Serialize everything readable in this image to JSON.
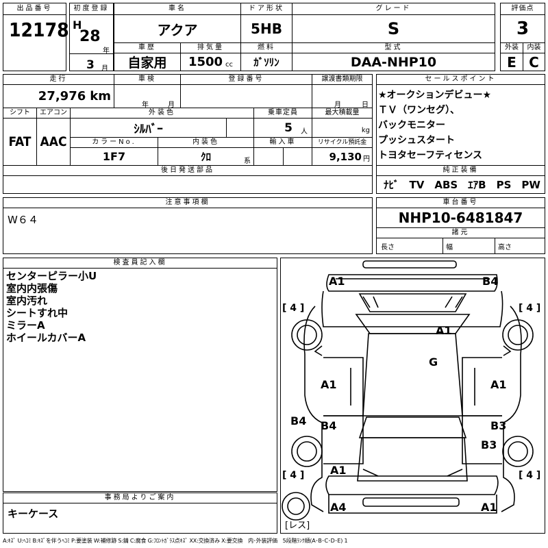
{
  "header": {
    "lot_label": "出品番号",
    "lot_value": "12178",
    "first_reg_label": "初度登録",
    "era": "H",
    "year_value": "28",
    "year_unit": "年",
    "month_value": "3",
    "month_unit": "月",
    "car_name_label": "車名",
    "car_name": "アクア",
    "door_label": "ドア形状",
    "door_value": "5HB",
    "grade_label": "グレード",
    "grade_value": "S",
    "score_label": "評価点",
    "score_value": "3",
    "history_label": "車歴",
    "history_value": "自家用",
    "displacement_label": "排気量",
    "displacement_value": "1500",
    "displacement_unit": "cc",
    "fuel_label": "燃料",
    "fuel_value": "ｶﾞｿﾘﾝ",
    "model_label": "型式",
    "model_value": "DAA-NHP10",
    "ext_label": "外装",
    "ext_value": "E",
    "int_label": "内装",
    "int_value": "C"
  },
  "specs": {
    "mileage_label": "走行",
    "mileage_value": "27,976",
    "mileage_unit": "km",
    "inspection_label": "車検",
    "year_unit": "年",
    "month_unit": "月",
    "reg_no_label": "登録番号",
    "transfer_label": "譲渡書類期限",
    "transfer_month": "月",
    "transfer_day": "日",
    "shift_label": "シフト",
    "shift_value": "FAT",
    "ac_label": "エアコン",
    "ac_value": "AAC",
    "ext_color_label": "外装色",
    "ext_color_value": "ｼﾙﾊﾞｰ",
    "capacity_label": "乗車定員",
    "capacity_value": "5",
    "capacity_unit": "人",
    "max_load_label": "最大積載量",
    "max_load_unit": "kg",
    "color_no_label": "カラーNo.",
    "color_no_value": "1F7",
    "int_color_label": "内装色",
    "int_color_value": "ｸﾛ",
    "int_color_unit": "系",
    "import_label": "輸入車",
    "recycle_label": "リサイクル預託金",
    "recycle_value": "9,130",
    "recycle_unit": "円",
    "later_parts_label": "後日発送部品"
  },
  "selling": {
    "label": "セールスポイント",
    "lines": [
      "★オークションデビュー★",
      "ＴＶ（ワンセグ）、",
      "バックモニター",
      "プッシュスタート",
      "トヨタセーフティセンス"
    ]
  },
  "equipment": {
    "label": "純正装備",
    "value": "ﾅﾋﾞ　TV　ABS　ｴｱB　PS　PW"
  },
  "notes": {
    "label": "注意事項欄",
    "value": "W６４"
  },
  "chassis": {
    "label": "車台番号",
    "value": "NHP10-6481847",
    "dims_label": "諸元",
    "length_label": "長さ",
    "width_label": "幅",
    "height_label": "高さ"
  },
  "inspector": {
    "label": "検査員記入欄",
    "lines": [
      "センターピラー小U",
      "室内内張傷",
      "室内汚れ",
      "シートすれ中",
      "ミラーA",
      "ホイールカバーA"
    ]
  },
  "office": {
    "label": "事務局よりご案内",
    "value": "キーケース"
  },
  "diagram": {
    "marks": [
      "A1",
      "B4",
      "A1",
      "G",
      "A1",
      "A1",
      "B4",
      "B4",
      "B3",
      "B3",
      "A1",
      "A4",
      "A1"
    ],
    "tires": [
      "4",
      "4",
      "4",
      "4"
    ],
    "spare": "レス"
  },
  "legend": "A:ｷｽﾞ U:ﾍｺﾐ B:ｷｽﾞを伴うﾍｺﾐ P:要塗装 W:補修跡 S:錆 C:腐食 G:ﾌﾛﾝﾄｶﾞﾗｽ点ｷｽﾞ XX:交換済み X:要交換　内･外装評価　5段階ﾗﾝｸ順(A･B･C･D･E) 1"
}
